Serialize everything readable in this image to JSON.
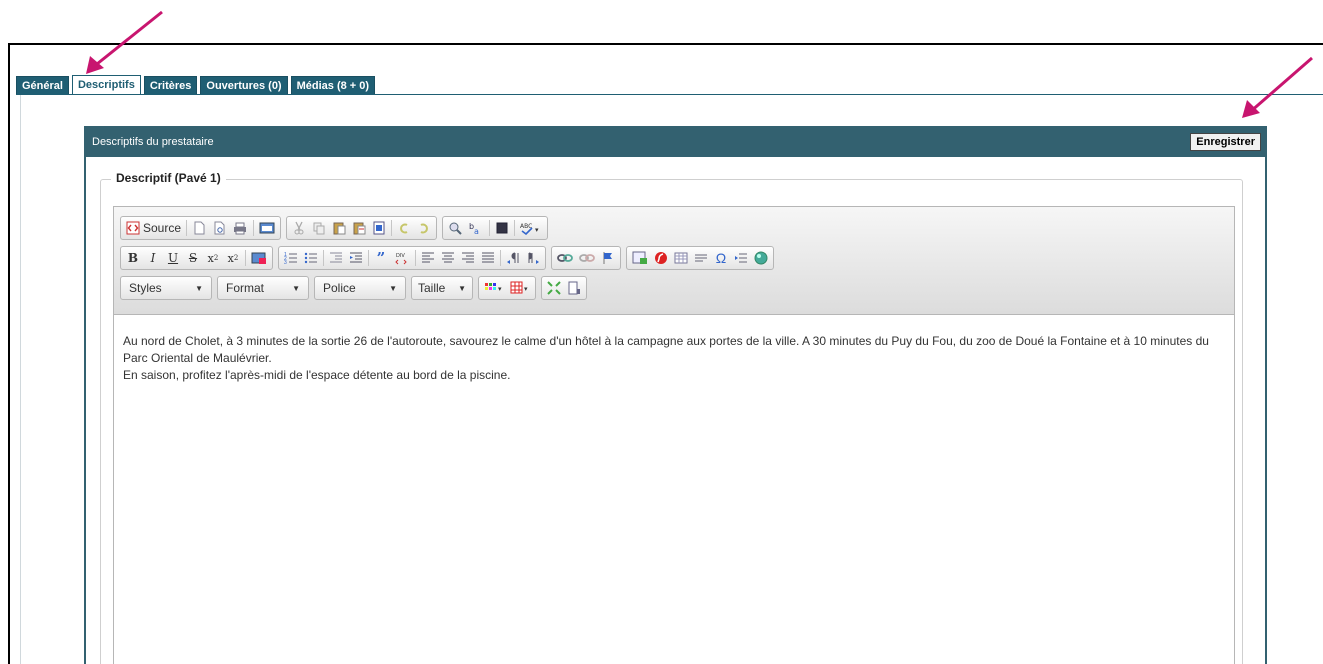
{
  "tabs": [
    {
      "label": "Général"
    },
    {
      "label": "Descriptifs"
    },
    {
      "label": "Critères"
    },
    {
      "label": "Ouvertures (0)"
    },
    {
      "label": "Médias  (8 + 0)"
    }
  ],
  "panel": {
    "header_title": "Descriptifs du prestataire",
    "save_label": "Enregistrer"
  },
  "fieldset": {
    "legend": "Descriptif (Pavé 1)"
  },
  "editor": {
    "source_label": "Source",
    "combos": {
      "styles": "Styles",
      "format": "Format",
      "font": "Police",
      "size": "Taille"
    },
    "paragraphs": [
      "Au nord de Cholet, à 3 minutes de la sortie 26 de l'autoroute, savourez le calme d'un hôtel à la campagne aux portes de la ville. A 30 minutes du Puy du Fou, du zoo de Doué la Fontaine et à 10 minutes du Parc Oriental de Maulévrier.",
      "En saison, profitez l'après-midi de l'espace détente au bord de la piscine."
    ]
  },
  "colors": {
    "tab_active_bg": "#ffffff",
    "tab_bg": "#1f5e73",
    "panel_header": "#336170",
    "annotation_arrow": "#c8156f"
  }
}
